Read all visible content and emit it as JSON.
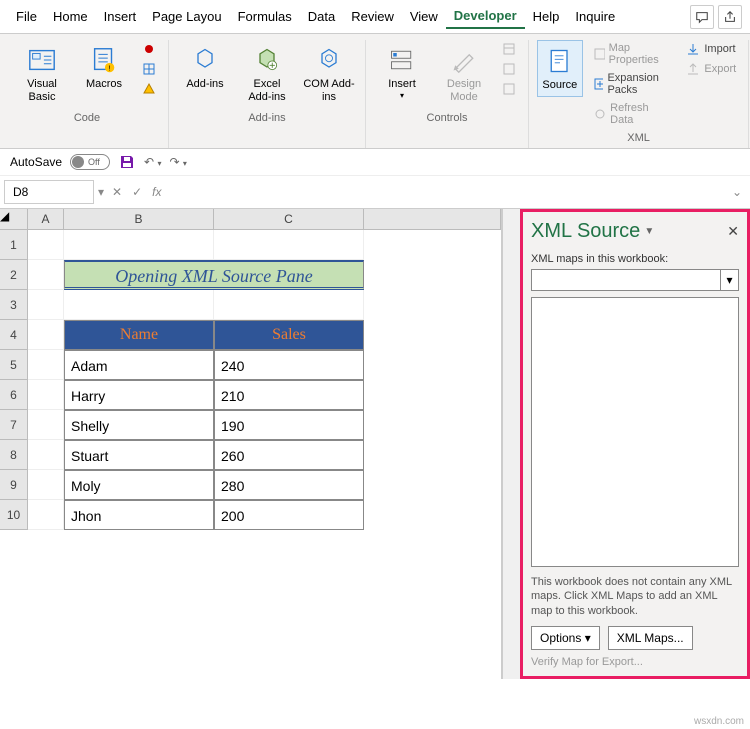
{
  "menu": {
    "items": [
      "File",
      "Home",
      "Insert",
      "Page Layou",
      "Formulas",
      "Data",
      "Review",
      "View",
      "Developer",
      "Help",
      "Inquire"
    ],
    "active": 8
  },
  "ribbon": {
    "code": {
      "vb": "Visual Basic",
      "macros": "Macros",
      "label": "Code"
    },
    "addins": {
      "addins": "Add-ins",
      "excel": "Excel Add-ins",
      "com": "COM Add-ins",
      "label": "Add-ins"
    },
    "controls": {
      "insert": "Insert",
      "design": "Design Mode",
      "label": "Controls"
    },
    "xml": {
      "source": "Source",
      "mapprops": "Map Properties",
      "expansion": "Expansion Packs",
      "refresh": "Refresh Data",
      "import": "Import",
      "export": "Export",
      "label": "XML"
    }
  },
  "qat": {
    "autosave": "AutoSave",
    "off": "Off"
  },
  "namebox": "D8",
  "sheet": {
    "cols": [
      "A",
      "B",
      "C"
    ],
    "rows": [
      "1",
      "2",
      "3",
      "4",
      "5",
      "6",
      "7",
      "8",
      "9",
      "10"
    ],
    "title": "Opening XML Source Pane",
    "headers": {
      "name": "Name",
      "sales": "Sales"
    },
    "data": [
      {
        "name": "Adam",
        "sales": "240"
      },
      {
        "name": "Harry",
        "sales": "210"
      },
      {
        "name": "Shelly",
        "sales": "190"
      },
      {
        "name": "Stuart",
        "sales": "260"
      },
      {
        "name": "Moly",
        "sales": "280"
      },
      {
        "name": "Jhon",
        "sales": "200"
      }
    ]
  },
  "pane": {
    "title": "XML Source",
    "maps_label": "XML maps in this workbook:",
    "msg": "This workbook does not contain any XML maps. Click XML Maps to add an XML map to this workbook.",
    "options": "Options",
    "xmlmaps": "XML Maps...",
    "verify": "Verify Map for Export..."
  },
  "watermark": "wsxdn.com"
}
